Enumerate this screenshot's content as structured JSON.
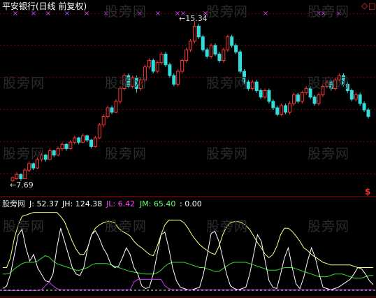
{
  "title": "平安银行(日线 前复权)",
  "watermark": "股旁网",
  "indicator_name": "股旁网",
  "price": {
    "high_label": "15.34",
    "low_label": "7.69",
    "candles": [
      [
        7.9,
        8.05,
        7.85,
        8.1,
        "up"
      ],
      [
        8.0,
        8.2,
        7.95,
        8.3,
        "up"
      ],
      [
        8.2,
        8.0,
        7.9,
        8.25,
        "dn"
      ],
      [
        8.0,
        8.4,
        7.98,
        8.5,
        "up"
      ],
      [
        8.4,
        8.7,
        8.3,
        8.8,
        "up"
      ],
      [
        8.7,
        8.5,
        8.4,
        8.75,
        "dn"
      ],
      [
        8.5,
        8.9,
        8.45,
        9.0,
        "up"
      ],
      [
        8.9,
        9.1,
        8.8,
        9.2,
        "up"
      ],
      [
        9.1,
        8.9,
        8.8,
        9.15,
        "dn"
      ],
      [
        8.9,
        9.3,
        8.85,
        9.4,
        "up"
      ],
      [
        9.3,
        9.1,
        9.0,
        9.35,
        "dn"
      ],
      [
        9.1,
        9.4,
        9.05,
        9.5,
        "up"
      ],
      [
        9.4,
        9.6,
        9.3,
        9.7,
        "up"
      ],
      [
        9.6,
        9.4,
        9.3,
        9.65,
        "dn"
      ],
      [
        9.4,
        9.7,
        9.35,
        9.8,
        "up"
      ],
      [
        9.7,
        9.9,
        9.6,
        10.0,
        "up"
      ],
      [
        9.9,
        9.7,
        9.6,
        9.95,
        "dn"
      ],
      [
        9.7,
        10.0,
        9.65,
        10.1,
        "up"
      ],
      [
        10.0,
        9.8,
        9.7,
        10.05,
        "dn"
      ],
      [
        9.8,
        9.5,
        9.4,
        9.85,
        "dn"
      ],
      [
        9.5,
        9.9,
        9.45,
        10.0,
        "up"
      ],
      [
        9.9,
        10.5,
        9.85,
        10.6,
        "up"
      ],
      [
        10.5,
        10.9,
        10.4,
        11.0,
        "up"
      ],
      [
        10.9,
        11.3,
        10.8,
        11.4,
        "up"
      ],
      [
        11.3,
        11.1,
        11.0,
        11.4,
        "dn"
      ],
      [
        11.1,
        11.6,
        11.05,
        11.7,
        "up"
      ],
      [
        11.6,
        12.2,
        11.5,
        12.3,
        "up"
      ],
      [
        12.2,
        12.8,
        12.1,
        12.9,
        "up"
      ],
      [
        12.8,
        12.3,
        12.2,
        12.9,
        "dn"
      ],
      [
        12.3,
        12.7,
        12.2,
        12.8,
        "up"
      ],
      [
        12.7,
        12.2,
        12.0,
        12.8,
        "dn"
      ],
      [
        12.2,
        12.6,
        12.1,
        12.7,
        "up"
      ],
      [
        12.6,
        13.2,
        12.5,
        13.3,
        "up"
      ],
      [
        13.2,
        13.5,
        13.1,
        13.6,
        "up"
      ],
      [
        13.5,
        13.0,
        12.9,
        13.6,
        "dn"
      ],
      [
        13.0,
        13.4,
        12.9,
        13.5,
        "up"
      ],
      [
        13.4,
        13.8,
        13.3,
        13.9,
        "up"
      ],
      [
        13.8,
        13.3,
        13.2,
        13.9,
        "dn"
      ],
      [
        13.3,
        12.8,
        12.7,
        13.4,
        "dn"
      ],
      [
        12.8,
        12.4,
        12.3,
        12.9,
        "dn"
      ],
      [
        12.4,
        13.0,
        12.3,
        13.1,
        "up"
      ],
      [
        13.0,
        13.5,
        12.9,
        13.6,
        "up"
      ],
      [
        13.5,
        14.0,
        13.4,
        14.1,
        "up"
      ],
      [
        14.0,
        14.4,
        13.9,
        14.5,
        "up"
      ],
      [
        14.4,
        15.1,
        14.3,
        15.34,
        "up"
      ],
      [
        15.1,
        14.6,
        14.5,
        15.2,
        "dn"
      ],
      [
        14.6,
        14.0,
        13.9,
        14.7,
        "dn"
      ],
      [
        14.0,
        13.7,
        13.6,
        14.1,
        "dn"
      ],
      [
        13.7,
        14.2,
        13.6,
        14.3,
        "up"
      ],
      [
        14.2,
        13.8,
        13.7,
        14.3,
        "dn"
      ],
      [
        13.8,
        13.5,
        13.4,
        13.9,
        "dn"
      ],
      [
        13.5,
        14.0,
        13.4,
        14.1,
        "up"
      ],
      [
        14.0,
        14.6,
        13.9,
        14.7,
        "up"
      ],
      [
        14.6,
        14.2,
        14.1,
        14.7,
        "dn"
      ],
      [
        14.2,
        13.9,
        13.8,
        14.3,
        "dn"
      ],
      [
        13.9,
        13.0,
        12.9,
        14.0,
        "dn"
      ],
      [
        13.0,
        12.5,
        12.4,
        13.1,
        "dn"
      ],
      [
        12.5,
        12.2,
        12.1,
        12.6,
        "dn"
      ],
      [
        12.2,
        12.5,
        12.1,
        12.6,
        "up"
      ],
      [
        12.5,
        12.1,
        12.0,
        12.6,
        "dn"
      ],
      [
        12.1,
        11.8,
        11.7,
        12.2,
        "dn"
      ],
      [
        11.8,
        12.1,
        11.7,
        12.2,
        "up"
      ],
      [
        12.1,
        11.6,
        11.5,
        12.2,
        "dn"
      ],
      [
        11.6,
        11.3,
        11.2,
        11.7,
        "dn"
      ],
      [
        11.3,
        11.0,
        10.9,
        11.4,
        "dn"
      ],
      [
        11.0,
        11.4,
        10.9,
        11.5,
        "up"
      ],
      [
        11.4,
        11.1,
        11.0,
        11.5,
        "dn"
      ],
      [
        11.1,
        11.5,
        11.0,
        11.6,
        "up"
      ],
      [
        11.5,
        11.9,
        11.4,
        12.0,
        "up"
      ],
      [
        11.9,
        11.6,
        11.5,
        12.0,
        "dn"
      ],
      [
        11.6,
        12.0,
        11.5,
        12.1,
        "up"
      ],
      [
        12.0,
        12.2,
        11.9,
        12.3,
        "up"
      ],
      [
        12.2,
        11.8,
        11.7,
        12.3,
        "dn"
      ],
      [
        11.8,
        11.5,
        11.4,
        11.9,
        "dn"
      ],
      [
        11.5,
        11.9,
        11.4,
        12.0,
        "up"
      ],
      [
        11.9,
        12.3,
        11.8,
        12.4,
        "up"
      ],
      [
        12.3,
        12.5,
        12.2,
        12.6,
        "up"
      ],
      [
        12.5,
        12.2,
        12.1,
        12.6,
        "dn"
      ],
      [
        12.2,
        12.6,
        12.1,
        12.7,
        "up"
      ],
      [
        12.6,
        12.8,
        12.5,
        12.9,
        "up"
      ],
      [
        12.8,
        12.4,
        12.3,
        12.9,
        "dn"
      ],
      [
        12.4,
        12.1,
        12.0,
        12.5,
        "dn"
      ],
      [
        12.1,
        11.7,
        11.6,
        12.2,
        "dn"
      ],
      [
        11.7,
        11.9,
        11.6,
        12.0,
        "up"
      ],
      [
        11.9,
        11.5,
        11.4,
        12.0,
        "dn"
      ],
      [
        11.5,
        11.2,
        11.1,
        11.6,
        "dn"
      ],
      [
        11.2,
        10.9,
        10.8,
        11.3,
        "dn"
      ]
    ]
  },
  "indicator": {
    "labels": [
      {
        "key": "J",
        "text": "J: 52.37",
        "color": "#ffffff"
      },
      {
        "key": "JH",
        "text": "JH: 124.38",
        "color": "#ffffff"
      },
      {
        "key": "JL",
        "text": "JL: 6.42",
        "color": "#ff44ff"
      },
      {
        "key": "JM",
        "text": "JM: 65.40",
        "color": "#66ff66"
      },
      {
        "key": "ZERO",
        "text": ": 0.00",
        "color": "#ffffff"
      }
    ],
    "colors": {
      "J": "#ffffff",
      "JH": "#ffff80",
      "JM": "#33dd33",
      "JL": "#cc33ff"
    }
  },
  "colors": {
    "up": "#ff3333",
    "down": "#33dddd",
    "grid": "#7a0000",
    "axis": "#a00000",
    "title": "#ffffff"
  }
}
